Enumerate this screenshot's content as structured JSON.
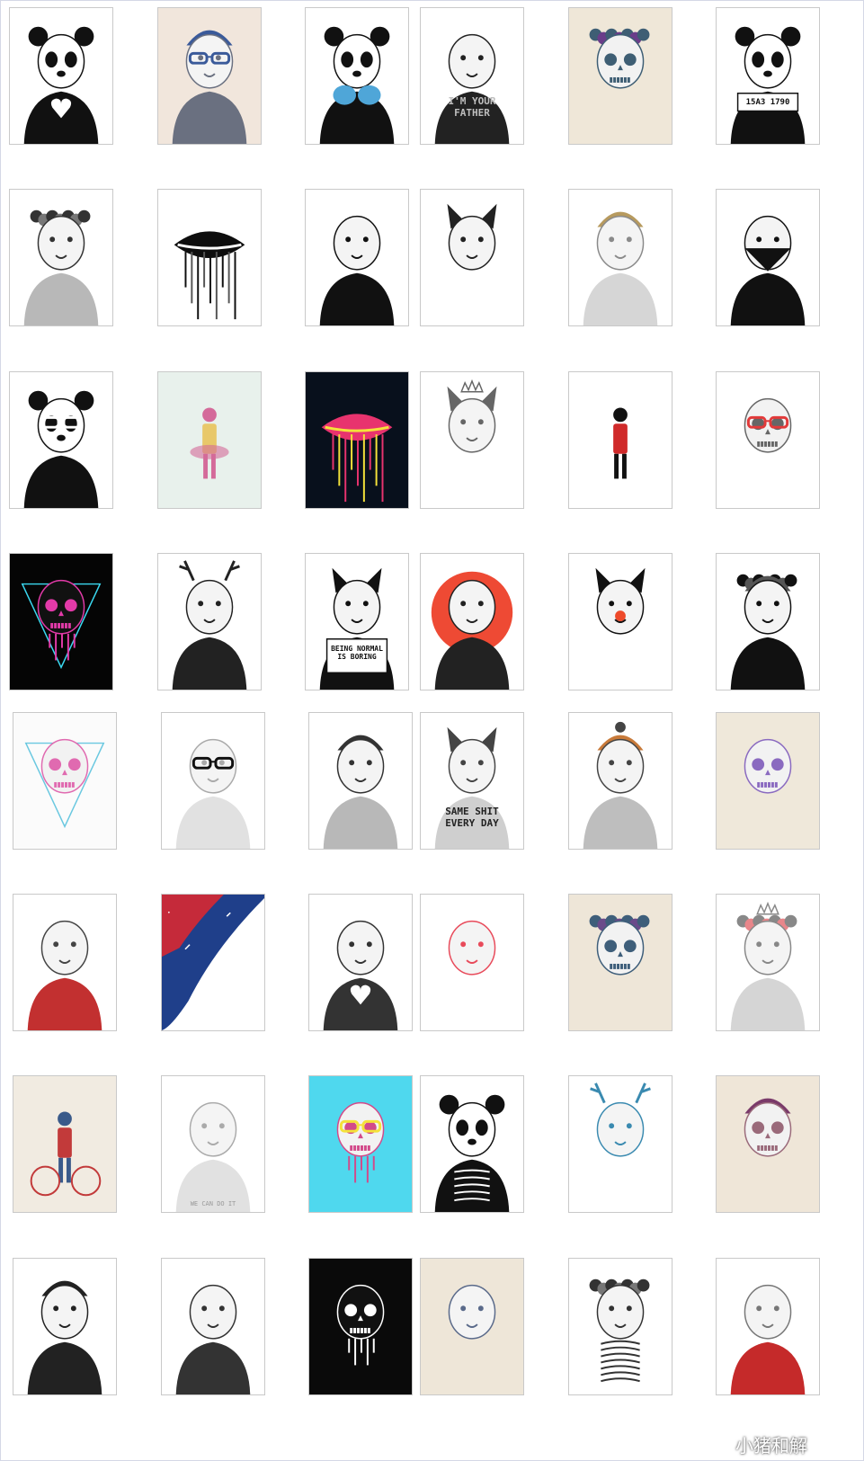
{
  "watermark": {
    "text": "小猪和解",
    "icon": "wechat-icon"
  },
  "posters": [
    {
      "subject": "panda-heart",
      "bg": "#ffffff",
      "ink": "#111111",
      "accent": "#ffffff"
    },
    {
      "subject": "lion-beanie-glasses",
      "bg": "#f1e6dc",
      "ink": "#6a7080",
      "accent": "#3a5a9a"
    },
    {
      "subject": "panda-boxing",
      "bg": "#ffffff",
      "ink": "#111111",
      "accent": "#4fa6d8"
    },
    {
      "subject": "chimp-sweater",
      "bg": "#ffffff",
      "ink": "#222222",
      "accent": "#777777",
      "text": "I'M YOUR\nFATHER"
    },
    {
      "subject": "skull-flowers",
      "bg": "#efe7d8",
      "ink": "#3e5e74",
      "accent": "#6a3d8a"
    },
    {
      "subject": "panda-mugshot",
      "bg": "#ffffff",
      "ink": "#111111",
      "accent": "#ffffff",
      "text": "15A3 1790"
    },
    {
      "subject": "lion-flowers",
      "bg": "#ffffff",
      "ink": "#333333",
      "accent": "#777777"
    },
    {
      "subject": "lips-dripping",
      "bg": "#ffffff",
      "ink": "#0e0e0e",
      "accent": "#555555"
    },
    {
      "subject": "woman-profile",
      "bg": "#ffffff",
      "ink": "#111111",
      "accent": "#444444"
    },
    {
      "subject": "bulldog-middle-finger",
      "bg": "#ffffff",
      "ink": "#222222",
      "accent": "#9a9a9a"
    },
    {
      "subject": "lion-knit-hat",
      "bg": "#ffffff",
      "ink": "#8a8a8a",
      "accent": "#b79a5e"
    },
    {
      "subject": "woman-bandana",
      "bg": "#ffffff",
      "ink": "#111111",
      "accent": "#555555"
    },
    {
      "subject": "panda-sunglasses",
      "bg": "#ffffff",
      "ink": "#111111",
      "accent": "#ffffff"
    },
    {
      "subject": "ballerina-girl",
      "bg": "#e8f1ec",
      "ink": "#d46a9a",
      "accent": "#e8c86a"
    },
    {
      "subject": "colorful-lips",
      "bg": "#08101c",
      "ink": "#e8336e",
      "accent": "#f4e23a"
    },
    {
      "subject": "cat-crown",
      "bg": "#ffffff",
      "ink": "#666666",
      "accent": "#b03a3a"
    },
    {
      "subject": "small-figure",
      "bg": "#ffffff",
      "ink": "#111111",
      "accent": "#d02a2a"
    },
    {
      "subject": "skull-red-glasses",
      "bg": "#ffffff",
      "ink": "#666666",
      "accent": "#e23a3a"
    },
    {
      "subject": "neon-skull-triangle",
      "bg": "#050505",
      "ink": "#e23aa8",
      "accent": "#3ad8f0"
    },
    {
      "subject": "bear-antlers",
      "bg": "#ffffff",
      "ink": "#222222",
      "accent": "#555555"
    },
    {
      "subject": "bulldog-sign",
      "bg": "#ffffff",
      "ink": "#111111",
      "accent": "#ffffff",
      "text": "BEING NORMAL\nIS BORING"
    },
    {
      "subject": "woman-red-sun",
      "bg": "#ffffff",
      "ink": "#222222",
      "accent": "#ee4a34"
    },
    {
      "subject": "bulldog-clown-nose",
      "bg": "#ffffff",
      "ink": "#111111",
      "accent": "#ee4a2a"
    },
    {
      "subject": "woman-flower-helmet",
      "bg": "#ffffff",
      "ink": "#111111",
      "accent": "#555555"
    },
    {
      "subject": "pink-skull-triangle",
      "bg": "#fbfbfb",
      "ink": "#e06ab0",
      "accent": "#6ac8e0"
    },
    {
      "subject": "polar-bear-sunglasses",
      "bg": "#ffffff",
      "ink": "#aaaaaa",
      "accent": "#111111"
    },
    {
      "subject": "tiger-bowler-hat",
      "bg": "#ffffff",
      "ink": "#333333",
      "accent": "#777777"
    },
    {
      "subject": "bulldog-hoodie",
      "bg": "#ffffff",
      "ink": "#444444",
      "accent": "#cfcfcf",
      "text": "SAME SHIT\nEVERY DAY"
    },
    {
      "subject": "tiger-pom-hat",
      "bg": "#ffffff",
      "ink": "#444444",
      "accent": "#c87a3a"
    },
    {
      "subject": "purple-skull-birds",
      "bg": "#efe8da",
      "ink": "#8a6ac0",
      "accent": "#5a6a8a"
    },
    {
      "subject": "lion-adidas-jacket",
      "bg": "#ffffff",
      "ink": "#444444",
      "accent": "#c23030"
    },
    {
      "subject": "climber-night",
      "bg": "#ffffff",
      "ink": "#1f3f8a",
      "accent": "#c52a3a"
    },
    {
      "subject": "leopard-hearts",
      "bg": "#ffffff",
      "ink": "#333333",
      "accent": "#777777"
    },
    {
      "subject": "leopard-lips",
      "bg": "#ffffff",
      "ink": "#e84a5a",
      "accent": "#f2a23a"
    },
    {
      "subject": "skull-headdress",
      "bg": "#eee6d8",
      "ink": "#3e5e7a",
      "accent": "#6a4a8a"
    },
    {
      "subject": "lion-flower-crown",
      "bg": "#ffffff",
      "ink": "#888888",
      "accent": "#e8868a"
    },
    {
      "subject": "cyclist",
      "bg": "#f1ebe1",
      "ink": "#3a5a8a",
      "accent": "#c23a3a"
    },
    {
      "subject": "polar-bear-bandana",
      "bg": "#ffffff",
      "ink": "#aaaaaa",
      "accent": "#5aa0d0",
      "text": "WE CAN DO IT"
    },
    {
      "subject": "skull-yellow-glasses",
      "bg": "#4fd8ee",
      "ink": "#d24a8a",
      "accent": "#f4e23a"
    },
    {
      "subject": "panda-skeleton",
      "bg": "#ffffff",
      "ink": "#111111",
      "accent": "#ffffff"
    },
    {
      "subject": "wolf-antlers",
      "bg": "#ffffff",
      "ink": "#3a8ab0",
      "accent": "#3ab0a0"
    },
    {
      "subject": "skull-beanie",
      "bg": "#efe6d8",
      "ink": "#9a6a7a",
      "accent": "#7a3a6a"
    },
    {
      "subject": "lion-bowler-hat",
      "bg": "#ffffff",
      "ink": "#222222",
      "accent": "#888888"
    },
    {
      "subject": "woman-portrait",
      "bg": "#ffffff",
      "ink": "#333333",
      "accent": "#777777"
    },
    {
      "subject": "skull-black",
      "bg": "#0a0a0a",
      "ink": "#ffffff",
      "accent": "#888888"
    },
    {
      "subject": "wolf-tongue",
      "bg": "#eee6d8",
      "ink": "#5a6a8a",
      "accent": "#d24a6a"
    },
    {
      "subject": "ribcage-flowers",
      "bg": "#ffffff",
      "ink": "#333333",
      "accent": "#777777"
    },
    {
      "subject": "lioness-cccp",
      "bg": "#ffffff",
      "ink": "#777777",
      "accent": "#c52a2a"
    }
  ]
}
